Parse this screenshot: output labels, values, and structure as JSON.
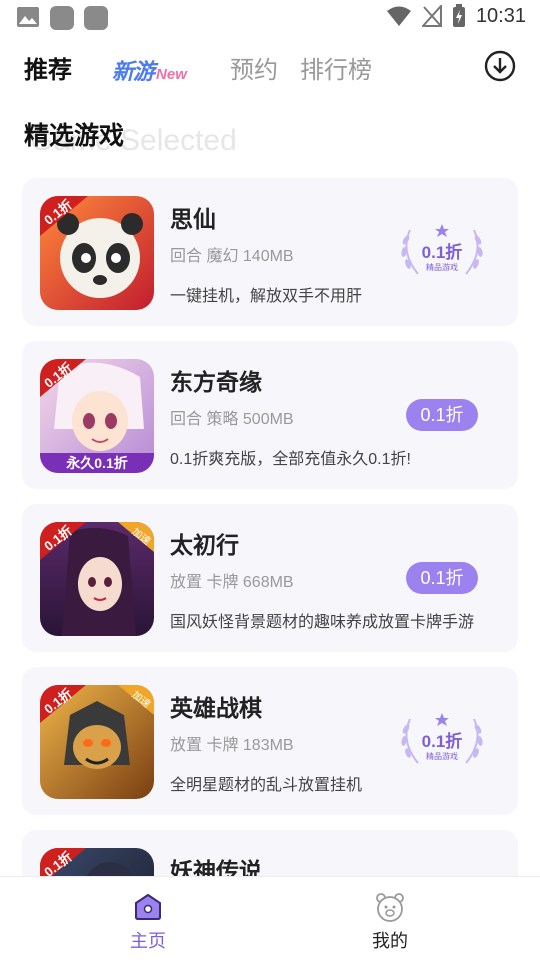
{
  "status_bar": {
    "time": "10:31"
  },
  "nav": {
    "tabs": [
      "推荐",
      "新游",
      "预约",
      "排行榜"
    ],
    "new_tag": "New"
  },
  "section": {
    "title": "精选游戏",
    "subtitle": "Game Selected"
  },
  "games": [
    {
      "name": "思仙",
      "meta": "回合 魔幻 140MB",
      "desc": "一键挂机，解放双手不用肝",
      "discount": "0.1折",
      "badge_style": "laurel",
      "badge_sub": "精品游戏",
      "thumb_label": "0.1折"
    },
    {
      "name": "东方奇缘",
      "meta": "回合 策略 500MB",
      "desc": "0.1折爽充版，全部充值永久0.1折!",
      "discount": "0.1折",
      "badge_style": "pill",
      "thumb_label": "0.1折",
      "thumb_banner": "永久0.1折"
    },
    {
      "name": "太初行",
      "meta": "放置 卡牌 668MB",
      "desc": "国风妖怪背景题材的趣味养成放置卡牌手游",
      "discount": "0.1折",
      "badge_style": "pill",
      "thumb_label": "0.1折",
      "thumb_corner": "加速"
    },
    {
      "name": "英雄战棋",
      "meta": "放置 卡牌 183MB",
      "desc": "全明星题材的乱斗放置挂机",
      "discount": "0.1折",
      "badge_style": "laurel",
      "badge_sub": "精品游戏",
      "thumb_label": "0.1折",
      "thumb_corner": "加速"
    },
    {
      "name": "妖神传说",
      "thumb_label": "0.1折"
    }
  ],
  "bottom_nav": {
    "home": "主页",
    "mine": "我的"
  },
  "colors": {
    "accent": "#7b5fe0",
    "pill": "#9b82ee",
    "card_bg": "#f7f7fb"
  }
}
